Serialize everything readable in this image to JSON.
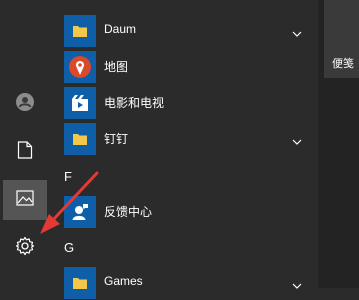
{
  "app_list": {
    "items": [
      {
        "label": "Daum",
        "icon": "folder-icon",
        "expandable": true
      },
      {
        "label": "地图",
        "icon": "map-pin-icon",
        "expandable": false
      },
      {
        "label": "电影和电视",
        "icon": "movies-tv-icon",
        "expandable": false
      },
      {
        "label": "钉钉",
        "icon": "folder-icon",
        "expandable": true
      }
    ],
    "section_f": "F",
    "feedback": {
      "label": "反馈中心",
      "icon": "feedback-hub-icon"
    },
    "section_g": "G",
    "games": {
      "label": "Games",
      "icon": "folder-icon",
      "expandable": true
    }
  },
  "right_tile": {
    "label": "便笺"
  },
  "sidebar": {
    "items": [
      {
        "name": "user-account",
        "icon": "user-icon"
      },
      {
        "name": "documents",
        "icon": "document-icon"
      },
      {
        "name": "pictures",
        "icon": "picture-icon"
      },
      {
        "name": "settings",
        "icon": "gear-icon"
      }
    ]
  },
  "colors": {
    "background": "#2b2b2b",
    "tile_blue": "#0f5fa8",
    "folder_yellow": "#f3c74a",
    "map_red": "#d84a2b",
    "arrow_red": "#e53935"
  }
}
